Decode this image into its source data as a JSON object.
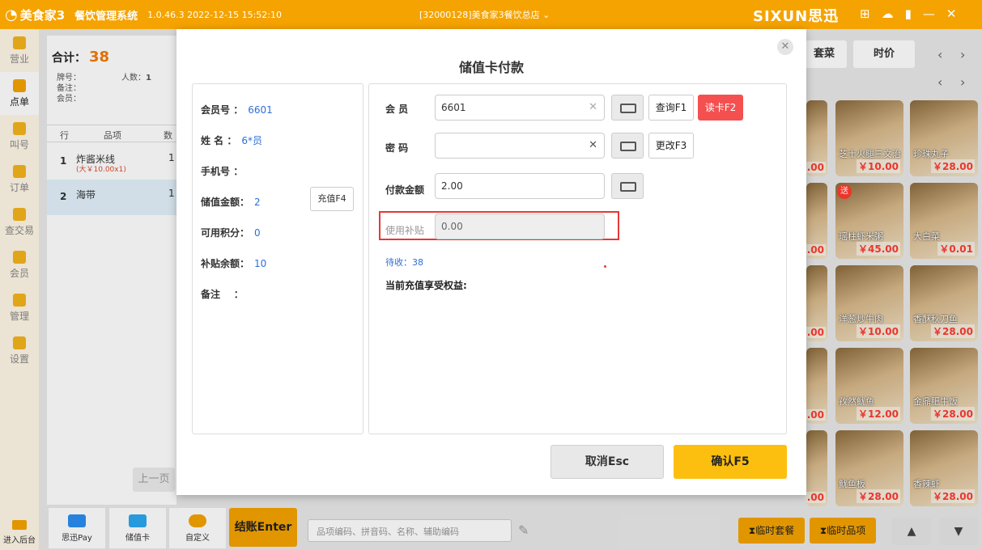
{
  "topbar": {
    "app_name": "美食家3",
    "system_name": "餐饮管理系统",
    "version": "1.0.46.3 2022-12-15 15:52:10",
    "store": "[32000128]美食家3餐饮总店",
    "brand": "SIXUN思迅",
    "icons": [
      "grid-icon",
      "cloud-icon",
      "signal-icon",
      "minimize-icon",
      "close-icon"
    ]
  },
  "leftnav": {
    "items": [
      {
        "label": "营业"
      },
      {
        "label": "点单"
      },
      {
        "label": "叫号"
      },
      {
        "label": "订单"
      },
      {
        "label": "查交易"
      },
      {
        "label": "会员"
      },
      {
        "label": "管理"
      },
      {
        "label": "设置"
      }
    ],
    "bottom_label": "进入后台"
  },
  "order": {
    "total_label": "合计：",
    "total_value": "38",
    "table_label": "牌号：",
    "people_label": "人数：",
    "people_value": "1",
    "note_label": "备注：",
    "member_label": "会员：",
    "columns": [
      "行",
      "品项",
      "数"
    ],
    "rows": [
      {
        "idx": "1",
        "name": "炸酱米线",
        "sub": "(大￥10.00x1)",
        "qty": "1"
      },
      {
        "idx": "2",
        "name": "海带",
        "sub": "",
        "qty": "1"
      }
    ],
    "prev_page": "上一页"
  },
  "paybar": {
    "buttons": [
      {
        "label": "思迅Pay"
      },
      {
        "label": "储值卡"
      },
      {
        "label": "自定义"
      }
    ],
    "checkout": "结账Enter",
    "search_placeholder": "品项编码、拼音码、名称、辅助编码"
  },
  "menu": {
    "categories": [
      "套菜",
      "时价"
    ],
    "dishes": [
      {
        "name": "",
        "price": ".00"
      },
      {
        "name": "芝士火腿三文治",
        "price": "￥10.00"
      },
      {
        "name": "珍珠丸子",
        "price": "￥28.00"
      },
      {
        "name": "",
        "price": ".00"
      },
      {
        "name": "瑶柱虾米粥",
        "price": "￥45.00"
      },
      {
        "name": "大白菜",
        "price": "￥0.01"
      },
      {
        "name": "",
        "price": ".00"
      },
      {
        "name": "洋葱炒牛肉",
        "price": "￥10.00"
      },
      {
        "name": "香酥秋刀鱼",
        "price": "￥28.00"
      },
      {
        "name": "",
        "price": ".00"
      },
      {
        "name": "孜然鱿鱼",
        "price": "￥12.00"
      },
      {
        "name": "金鼎肥牛饭",
        "price": "￥28.00"
      },
      {
        "name": "",
        "price": ".00"
      },
      {
        "name": "鱿鱼板",
        "price": "￥28.00"
      },
      {
        "name": "香辣虾",
        "price": "￥28.00"
      }
    ],
    "send_tag": "送",
    "temp_set": "临时套餐",
    "temp_item": "临时品项"
  },
  "modal": {
    "title": "储值卡付款",
    "info": {
      "member_no_label": "会员号",
      "member_no": "6601",
      "name_label": "姓  名",
      "name": "6*员",
      "phone_label": "手机号",
      "phone": "",
      "balance_label": "储值金额：",
      "balance": "2",
      "points_label": "可用积分：",
      "points": "0",
      "subsidy_label": "补贴余额：",
      "subsidy": "10",
      "remark_label": "备注",
      "remark": "",
      "recharge_button": "充值F4"
    },
    "form": {
      "member_label": "会  员",
      "member_value": "6601",
      "query_button": "查询F1",
      "read_card_button": "读卡F2",
      "password_label": "密  码",
      "password_value": "",
      "change_button": "更改F3",
      "amount_label": "付款金额",
      "amount_value": "2.00",
      "subsidy_label": "使用补贴",
      "subsidy_value": "0.00",
      "pending": "待收：38",
      "benefit": "当前充值享受权益:"
    },
    "cancel_button": "取消Esc",
    "confirm_button": "确认F5"
  }
}
